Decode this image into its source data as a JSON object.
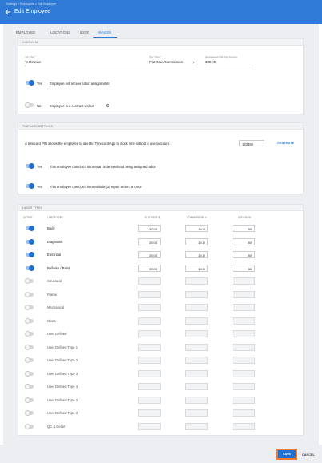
{
  "header": {
    "breadcrumb": "Settings > Employees > Edit Employee",
    "title": "Edit Employee"
  },
  "tabs": [
    {
      "label": "EMPLOYEE"
    },
    {
      "label": "LOCATIONS"
    },
    {
      "label": "USER"
    },
    {
      "label": "WAGES",
      "active": true
    }
  ],
  "overview": {
    "section_title": "OVERVIEW",
    "job_title_label": "Job Title *",
    "job_title_value": "Technician",
    "pay_type_label": "Pay Type *",
    "pay_type_value": "Flat Rate/Commission",
    "pay_amount_label": "Guaranteed Flat Pay Amount",
    "pay_amount_value": "800.00",
    "labor_toggle_state": "Yes",
    "labor_toggle_text": "Employee will receive labor assignments",
    "contract_toggle_state": "No",
    "contract_toggle_text": "Employee is a contract worker",
    "info_glyph": "i"
  },
  "timecard": {
    "section_title": "TIMECARD SETTINGS",
    "pin_text": "A timecard PIN allows the employee to use the Timecard App to clock time without a user account.",
    "pin_value": "123456",
    "generate_label": "GENERATE",
    "toggle1_state": "Yes",
    "toggle1_text": "This employee can clock into repair orders without being assigned labor",
    "toggle2_state": "Yes",
    "toggle2_text": "This employee can clock into multiple (2) repair orders at once"
  },
  "labor": {
    "section_title": "LABOR TYPES",
    "col_active": "ACTIVE",
    "col_type": "LABOR TYPE",
    "col_flat": "FLAT RATE $",
    "col_commission": "COMMISSION %",
    "col_addon": "ADD ON %",
    "rows": [
      {
        "name": "Body",
        "active": true,
        "flat": "20.00",
        "commission": "10.0",
        "addon": "80"
      },
      {
        "name": "Diagnostic",
        "active": true,
        "flat": "20.00",
        "commission": "10.0",
        "addon": "80"
      },
      {
        "name": "Electrical",
        "active": true,
        "flat": "20.00",
        "commission": "10.0",
        "addon": "80"
      },
      {
        "name": "Refinish / Paint",
        "active": true,
        "flat": "20.00",
        "commission": "10.0",
        "addon": "80"
      },
      {
        "name": "Structural",
        "active": false,
        "flat": "",
        "commission": "",
        "addon": ""
      },
      {
        "name": "Frame",
        "active": false,
        "flat": "",
        "commission": "",
        "addon": ""
      },
      {
        "name": "Mechanical",
        "active": false,
        "flat": "",
        "commission": "",
        "addon": ""
      },
      {
        "name": "Glass",
        "active": false,
        "flat": "",
        "commission": "",
        "addon": ""
      },
      {
        "name": "User Defined",
        "active": false,
        "flat": "",
        "commission": "",
        "addon": ""
      },
      {
        "name": "User Defined Type 1",
        "active": false,
        "flat": "",
        "commission": "",
        "addon": ""
      },
      {
        "name": "User Defined Type 2",
        "active": false,
        "flat": "",
        "commission": "",
        "addon": ""
      },
      {
        "name": "User Defined Type 3",
        "active": false,
        "flat": "",
        "commission": "",
        "addon": ""
      },
      {
        "name": "User Defined Type 4",
        "active": false,
        "flat": "",
        "commission": "",
        "addon": ""
      },
      {
        "name": "User Defined Type 2",
        "active": false,
        "flat": "",
        "commission": "",
        "addon": ""
      },
      {
        "name": "User Defined Type 3",
        "active": false,
        "flat": "",
        "commission": "",
        "addon": ""
      },
      {
        "name": "QC & Detail",
        "active": false,
        "flat": "",
        "commission": "",
        "addon": ""
      }
    ]
  },
  "footer": {
    "save_label": "SAVE",
    "cancel_label": "CANCEL"
  },
  "colors": {
    "primary": "#2f7ad6",
    "highlight": "#f07a2e",
    "toggle_on": "#1f6fd4"
  }
}
